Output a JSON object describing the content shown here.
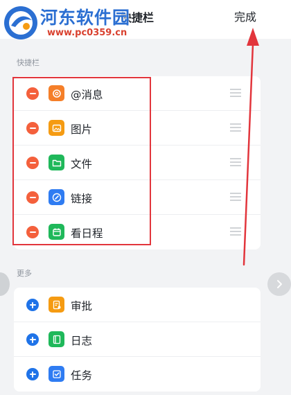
{
  "header": {
    "title": "快捷栏",
    "done_label": "完成"
  },
  "watermark": {
    "title": "河东软件园",
    "url": "www.pc0359.cn"
  },
  "sections": {
    "quickbar_title": "快捷栏",
    "more_title": "更多"
  },
  "quickbar_items": [
    {
      "label": "@消息",
      "icon": "at-message-icon",
      "color": "#f57f29"
    },
    {
      "label": "图片",
      "icon": "image-icon",
      "color": "#f59b12"
    },
    {
      "label": "文件",
      "icon": "folder-icon",
      "color": "#1fb85a"
    },
    {
      "label": "链接",
      "icon": "link-icon",
      "color": "#2f7cf2"
    },
    {
      "label": "看日程",
      "icon": "calendar-icon",
      "color": "#1fb85a"
    }
  ],
  "more_items": [
    {
      "label": "审批",
      "icon": "approval-icon",
      "color": "#f59b12"
    },
    {
      "label": "日志",
      "icon": "log-icon",
      "color": "#1fb85a"
    },
    {
      "label": "任务",
      "icon": "task-icon",
      "color": "#2f7cf2"
    }
  ],
  "colors": {
    "remove_button": "#f4603c",
    "add_button": "#1f73e8",
    "highlight": "#e2353c"
  }
}
